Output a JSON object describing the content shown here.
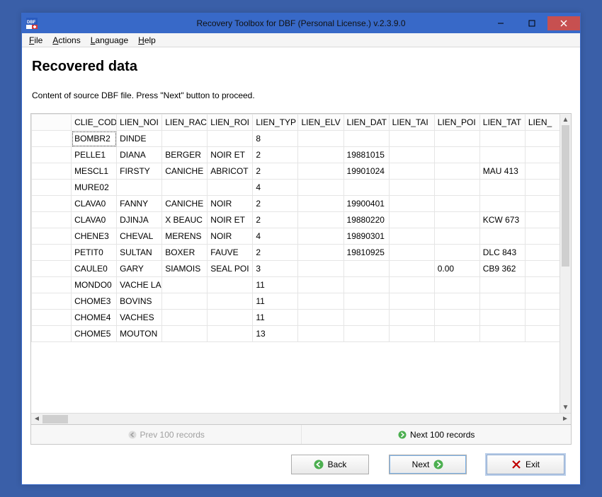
{
  "window": {
    "title": "Recovery Toolbox for DBF (Personal License.) v.2.3.9.0"
  },
  "menubar": {
    "items": [
      {
        "label": "File",
        "accel": "F"
      },
      {
        "label": "Actions",
        "accel": "A"
      },
      {
        "label": "Language",
        "accel": "L"
      },
      {
        "label": "Help",
        "accel": "H"
      }
    ]
  },
  "page": {
    "title": "Recovered data",
    "instruction": "Content of source DBF file. Press \"Next\" button to proceed."
  },
  "grid": {
    "columns": [
      "CLIE_COD",
      "LIEN_NOI",
      "LIEN_RAC",
      "LIEN_ROI",
      "LIEN_TYP",
      "LIEN_ELV",
      "LIEN_DAT",
      "LIEN_TAI",
      "LIEN_POI",
      "LIEN_TAT",
      "LIEN_"
    ],
    "rows": [
      [
        "BOMBR2",
        "DINDE",
        "",
        "",
        "8",
        "",
        "",
        "",
        "",
        "",
        ""
      ],
      [
        "PELLE1",
        "DIANA",
        "BERGER",
        "NOIR ET",
        "2",
        "",
        "19881015",
        "",
        "",
        "",
        ""
      ],
      [
        "MESCL1",
        "FIRSTY",
        "CANICHE",
        "ABRICOT",
        "2",
        "",
        "19901024",
        "",
        "",
        "MAU 413",
        ""
      ],
      [
        "MURE02",
        "",
        "",
        "",
        "4",
        "",
        "",
        "",
        "",
        "",
        ""
      ],
      [
        "CLAVA0",
        "FANNY",
        "CANICHE",
        "NOIR",
        "2",
        "",
        "19900401",
        "",
        "",
        "",
        ""
      ],
      [
        "CLAVA0",
        "DJINJA",
        "X BEAUC",
        "NOIR ET",
        "2",
        "",
        "19880220",
        "",
        "",
        "KCW 673",
        ""
      ],
      [
        "CHENE3",
        "CHEVAL",
        "MERENS",
        "NOIR",
        "4",
        "",
        "19890301",
        "",
        "",
        "",
        ""
      ],
      [
        "PETIT0",
        "SULTAN",
        "BOXER",
        "FAUVE",
        "2",
        "",
        "19810925",
        "",
        "",
        "DLC 843",
        ""
      ],
      [
        "CAULE0",
        "GARY",
        "SIAMOIS",
        "SEAL POI",
        "3",
        "",
        "",
        "",
        "0.00",
        "CB9 362",
        ""
      ],
      [
        "MONDO0",
        "VACHE LA",
        "",
        "",
        "11",
        "",
        "",
        "",
        "",
        "",
        ""
      ],
      [
        "CHOME3",
        "BOVINS",
        "",
        "",
        "11",
        "",
        "",
        "",
        "",
        "",
        ""
      ],
      [
        "CHOME4",
        "VACHES",
        "",
        "",
        "11",
        "",
        "",
        "",
        "",
        "",
        ""
      ],
      [
        "CHOME5",
        "MOUTON",
        "",
        "",
        "13",
        "",
        "",
        "",
        "",
        "",
        ""
      ]
    ]
  },
  "pager": {
    "prev": "Prev 100 records",
    "next": "Next 100 records"
  },
  "buttons": {
    "back": "Back",
    "next": "Next",
    "exit": "Exit"
  }
}
